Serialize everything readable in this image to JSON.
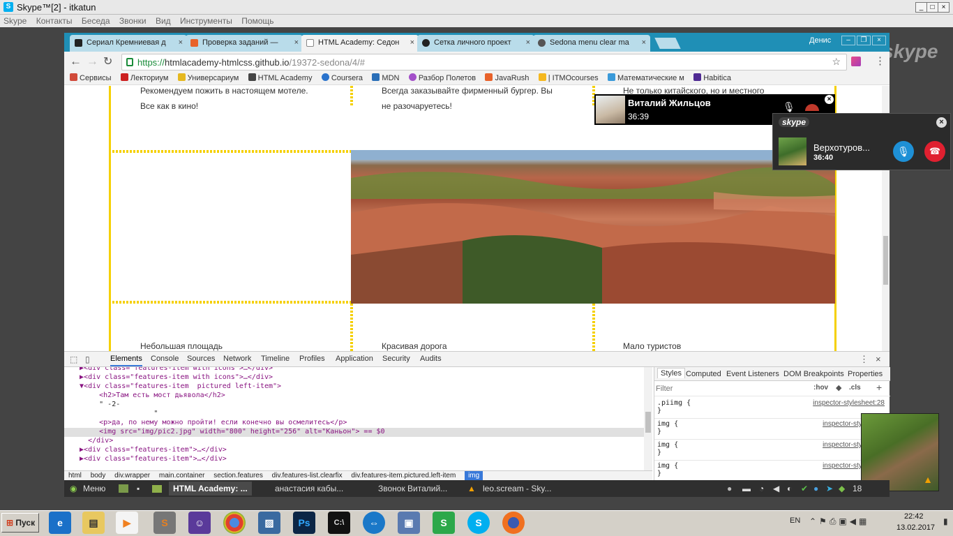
{
  "skype": {
    "window_title": "Skype™[2] - itkatun",
    "menu": [
      "Skype",
      "Контакты",
      "Беседа",
      "Звонки",
      "Вид",
      "Инструменты",
      "Помощь"
    ],
    "watermark": "skype"
  },
  "browser": {
    "tabs": [
      {
        "label": "Сериал Кремниевая д",
        "close": "×"
      },
      {
        "label": "Проверка заданий — ",
        "close": "×"
      },
      {
        "label": "HTML Academy: Седон",
        "close": "×"
      },
      {
        "label": "Сетка личного проект",
        "close": "×"
      },
      {
        "label": "Sedona menu clear ma",
        "close": "×"
      }
    ],
    "user": "Денис",
    "url_https": "https://",
    "url_host": "htmlacademy-htmlcss.github.io",
    "url_path": "/19372-sedona/4/#",
    "bookmarks": [
      "Сервисы",
      "Лекториум",
      "Универсариум",
      "HTML Academy",
      "Coursera",
      "MDN",
      "Разбор Полетов",
      "JavaRush",
      "| ITMOcourses",
      "Математические м",
      "Habitica"
    ]
  },
  "page": {
    "col1_text_line1": "Рекомендуем пожить в настоящем мотеле.",
    "col1_text_line2": "Все как в кино!",
    "col2_text_line1": "Всегда заказывайте фирменный бургер. Вы",
    "col2_text_line2": "не разочаруетесь!",
    "col3_text_line1": "Не только китайского, но и местного",
    "bottom_titles": [
      "Небольшая площадь",
      "Красивая дорога",
      "Мало туристов"
    ]
  },
  "devtools": {
    "tabs": [
      "Elements",
      "Console",
      "Sources",
      "Network",
      "Timeline",
      "Profiles",
      "Application",
      "Security",
      "Audits"
    ],
    "elements": [
      {
        "text": "   ▶<div class=\"features-item with icons\">…</div>"
      },
      {
        "text": "   ▶<div class=\"features-item with icons\">…</div>"
      },
      {
        "text": "   ▼<div class=\"features-item  pictured left-item\">"
      },
      {
        "text": "       <h2>Там есть мост дьявола</h2>"
      },
      {
        "text": "       \" -2-"
      },
      {
        "text": "                    \""
      },
      {
        "text": "       <p>да, по нему можно пройти! если конечно вы осмелитесь</p>"
      },
      {
        "text": "       <img src=\"img/pic2.jpg\" width=\"800\" height=\"256\" alt=\"Каньон\"> == $0"
      },
      {
        "text": "     </div>"
      },
      {
        "text": "   ▶<div class=\"features-item\">…</div>"
      },
      {
        "text": "   ▶<div class=\"features-item\">…</div>"
      }
    ],
    "breadcrumbs": [
      "html",
      "body",
      "div.wrapper",
      "main.container",
      "section.features",
      "div.features-list.clearfix",
      "div.features-item.pictured.left-item",
      "img"
    ],
    "styles_tabs": [
      "Styles",
      "Computed",
      "Event Listeners",
      "DOM Breakpoints",
      "Properties"
    ],
    "filter_placeholder": "Filter",
    "hov": ":hov",
    "cls": ".cls",
    "rules": [
      {
        "selector": ".piimg {",
        "close": "}",
        "source": "inspector-stylesheet:28"
      },
      {
        "selector": "img {",
        "close": "}",
        "source": "inspector-stylesheet"
      },
      {
        "selector": "img {",
        "close": "}",
        "source": "inspector-stylesheet"
      },
      {
        "selector": "img {",
        "close": "}",
        "source": "inspector-stylesheet"
      }
    ]
  },
  "calls": {
    "call1": {
      "name": "Виталий Жильцов",
      "time": "36:39",
      "close": "×"
    },
    "call2": {
      "brand": "skype",
      "name": "Верхотуров...",
      "time": "36:40",
      "close": "×"
    }
  },
  "mint_panel": {
    "menu": "Меню",
    "windows": [
      "HTML Academy: ...",
      "анастасия кабы...",
      "Звонок Виталий...",
      "leo.scream - Sky..."
    ],
    "tray_num": "18"
  },
  "taskbar": {
    "start": "Пуск",
    "lang": "EN",
    "time": "22:42",
    "date": "13.02.2017"
  },
  "colors": {
    "chrome_tabbar": "#1f8fb6",
    "yellow_guides": "#f5d000",
    "devtools_accent": "#3879d9",
    "skype_blue": "#00aff0",
    "hangup_red": "#e02030"
  }
}
